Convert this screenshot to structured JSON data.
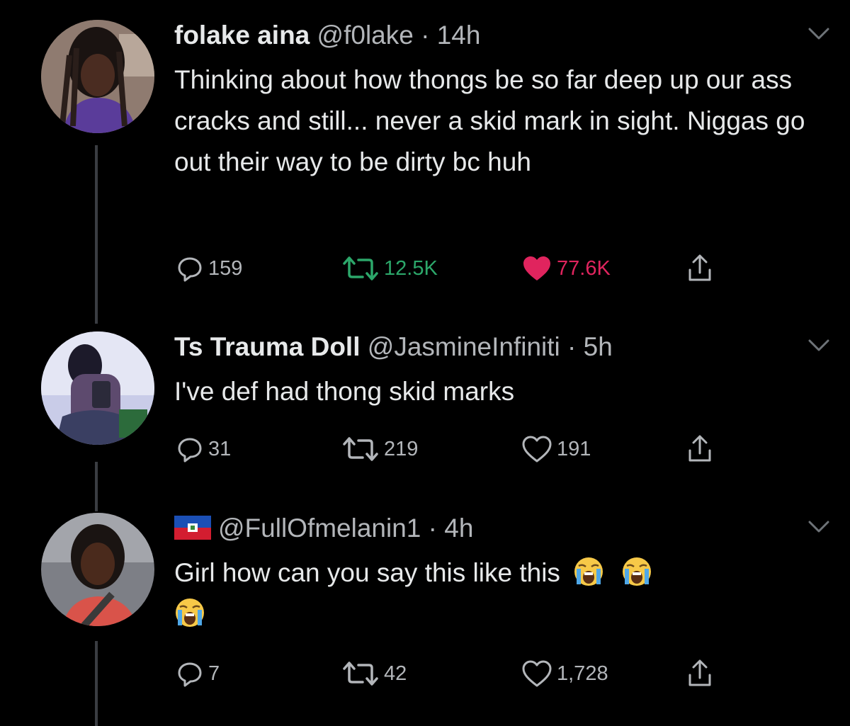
{
  "tweets": [
    {
      "name": "folake aina",
      "handle": "@f0lake",
      "separator": "·",
      "time": "14h",
      "text": "Thinking about how thongs be so far deep up our ass cracks and still... never a skid mark in sight. Niggas go out their way to be dirty bc huh",
      "replies": "159",
      "retweets": "12.5K",
      "likes": "77.6K",
      "retweeted": true,
      "liked": true
    },
    {
      "name": "Ts Trauma Doll",
      "handle": "@JasmineInfiniti",
      "separator": "·",
      "time": "5h",
      "text": "I've def had thong skid marks",
      "replies": "31",
      "retweets": "219",
      "likes": "191",
      "retweeted": false,
      "liked": false
    },
    {
      "name": "",
      "name_flag": "haiti-flag",
      "handle": "@FullOfmelanin1",
      "separator": "·",
      "time": "4h",
      "text": "Girl how can you say this like this",
      "text_emojis": [
        "loudly-crying-face",
        "loudly-crying-face",
        "loudly-crying-face"
      ],
      "replies": "7",
      "retweets": "42",
      "likes": "1,728",
      "retweeted": false,
      "liked": false
    }
  ],
  "colors": {
    "background": "#000000",
    "text": "#e7e9ea",
    "muted": "#b3b6ba",
    "retweet_active": "#2ca76a",
    "like_active": "#e0245e",
    "thread_line": "#3a3d42"
  },
  "icons": [
    "reply-icon",
    "retweet-icon",
    "like-icon",
    "share-icon",
    "chevron-down-icon"
  ]
}
